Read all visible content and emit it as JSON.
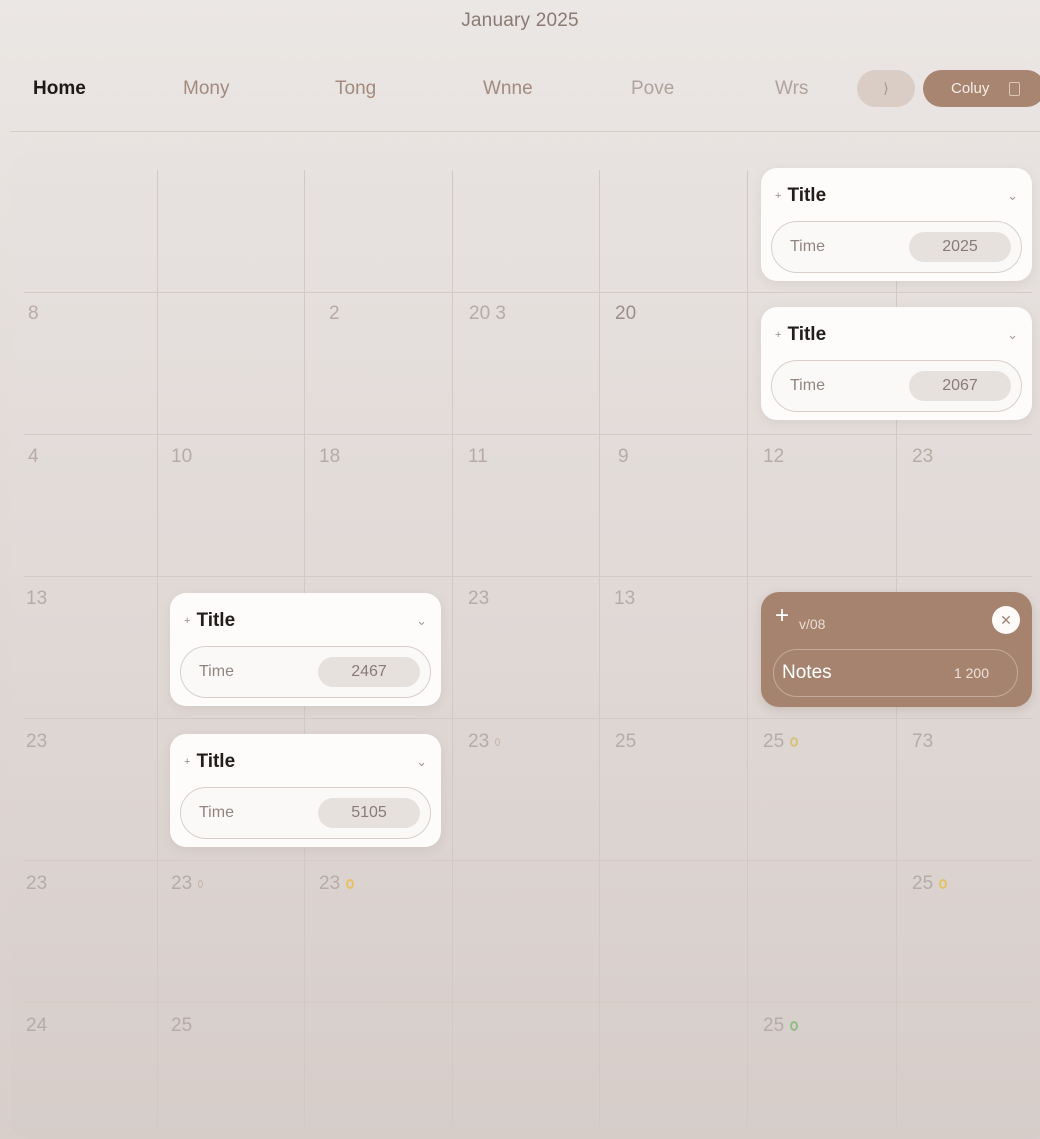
{
  "header": {
    "title": "January 2025"
  },
  "nav": {
    "items": [
      "Home",
      "Mony",
      "Tong",
      "Wnne",
      "Pove",
      "Wrs"
    ],
    "pill_neutral_glyph": "⟩",
    "pill_accent_label": "Coluy"
  },
  "grid": {
    "day_labels": [
      "8",
      "2",
      "20 3",
      "20",
      "4",
      "10",
      "18",
      "11",
      "9",
      "12",
      "23",
      "13",
      "23",
      "13",
      "23",
      "23",
      "25",
      "25",
      "73",
      "23",
      "23",
      "23",
      "25",
      "24",
      "25",
      "25"
    ]
  },
  "cards": [
    {
      "title": "Title",
      "time_label": "Time",
      "time_value": "2025"
    },
    {
      "title": "Title",
      "time_label": "Time",
      "time_value": "2067"
    },
    {
      "title": "Title",
      "time_label": "Time",
      "time_value": "2467"
    },
    {
      "title": "Title",
      "time_label": "Time",
      "time_value": "5105"
    }
  ],
  "note_card": {
    "subtitle": "v/08",
    "row_label": "Notes",
    "row_value": "1 200"
  },
  "colors": {
    "accent": "#a6836f",
    "background": "#e5dfdc",
    "dot_yellow": "#e4c262",
    "dot_green": "#8fbf83"
  },
  "icons": [
    "plus-icon",
    "chevron-down-icon",
    "close-icon",
    "square-icon"
  ]
}
